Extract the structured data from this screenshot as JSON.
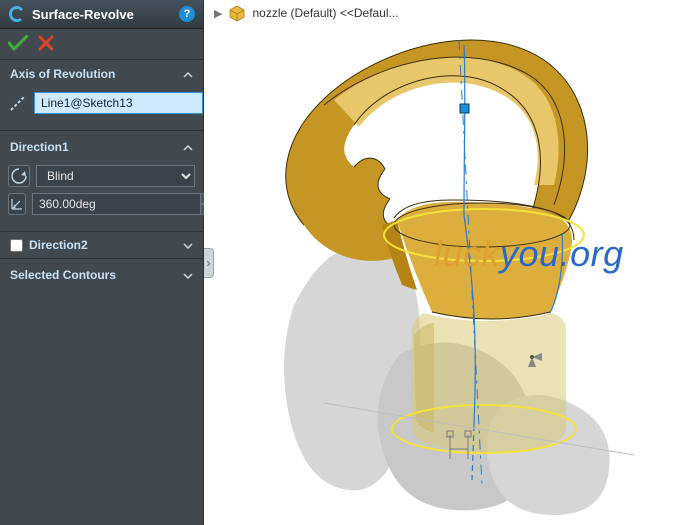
{
  "featureTitle": "Surface-Revolve",
  "sections": {
    "axis": {
      "title": "Axis of Revolution",
      "selection": "Line1@Sketch13"
    },
    "direction1": {
      "title": "Direction1",
      "typeOptions": [
        "Blind"
      ],
      "typeSelected": "Blind",
      "angle": "360.00deg"
    },
    "direction2": {
      "title": "Direction2",
      "enabled": false
    },
    "contours": {
      "title": "Selected Contours"
    }
  },
  "breadcrumb": {
    "partName": "nozzle (Default) <<Defaul..."
  },
  "watermark": {
    "a": "luck",
    "b": "you.org"
  }
}
